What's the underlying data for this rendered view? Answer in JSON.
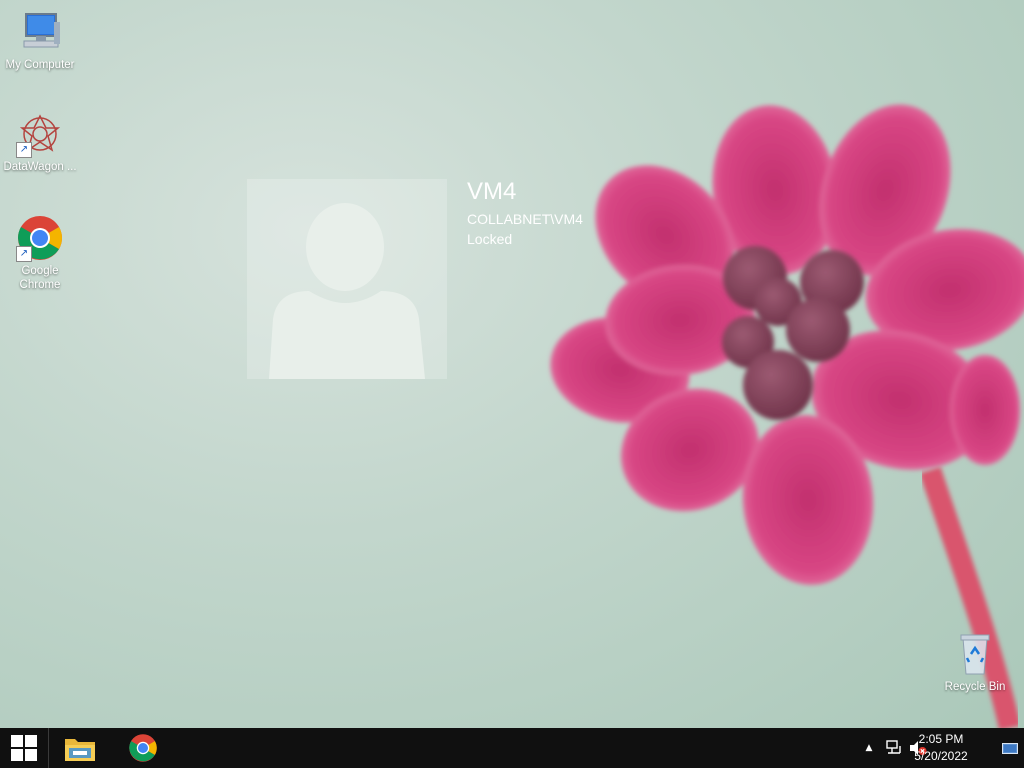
{
  "desktop": {
    "icons": [
      {
        "label": "My Computer",
        "icon": "computer-icon"
      },
      {
        "label": "DataWagon ...",
        "icon": "datawagon-icon"
      },
      {
        "label": "Google Chrome",
        "icon": "chrome-icon"
      },
      {
        "label": "Recycle Bin",
        "icon": "recycle-bin-icon"
      }
    ]
  },
  "lock_screen": {
    "user_name": "VM4",
    "account": "COLLABNET\\VM4",
    "status": "Locked"
  },
  "taskbar": {
    "apps": [
      {
        "name": "file-explorer",
        "icon": "folder-icon"
      },
      {
        "name": "google-chrome",
        "icon": "chrome-icon"
      }
    ],
    "tray": {
      "overflow_glyph": "▲",
      "network_icon": "network-icon",
      "volume_icon": "volume-muted-icon"
    },
    "clock": {
      "time": "2:05 PM",
      "date": "5/20/2022"
    }
  },
  "colors": {
    "taskbar": "#101010",
    "flower": "#d53f7f",
    "wallpaper_mint": "#a9c7b8"
  }
}
